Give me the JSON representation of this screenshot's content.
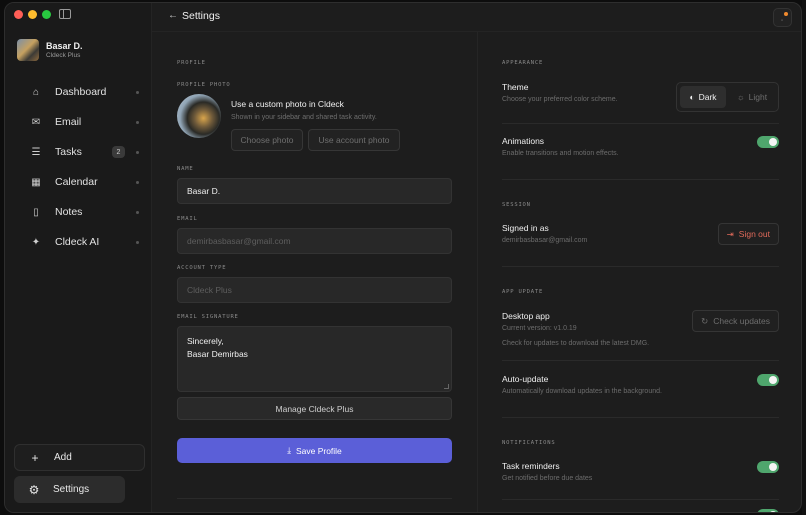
{
  "window": {
    "title": "Settings"
  },
  "sidebar": {
    "user": {
      "name": "Basar D.",
      "plan": "Cldeck Plus"
    },
    "items": [
      {
        "label": "Dashboard",
        "icon": "home-icon",
        "glyph": "⌂"
      },
      {
        "label": "Email",
        "icon": "mail-icon",
        "glyph": "✉"
      },
      {
        "label": "Tasks",
        "icon": "list-icon",
        "glyph": "☰",
        "badge": "2"
      },
      {
        "label": "Calendar",
        "icon": "calendar-icon",
        "glyph": "▦"
      },
      {
        "label": "Notes",
        "icon": "note-icon",
        "glyph": "▯"
      },
      {
        "label": "Cldeck AI",
        "icon": "ai-icon",
        "glyph": "✦"
      }
    ],
    "add_label": "Add",
    "settings_label": "Settings"
  },
  "profile_section": {
    "label": "PROFILE",
    "photo_label": "PROFILE PHOTO",
    "photo_title": "Use a custom photo in Cldeck",
    "photo_desc": "Shown in your sidebar and shared task activity.",
    "choose_photo": "Choose photo",
    "use_account_photo": "Use account photo",
    "name_label": "NAME",
    "name_value": "Basar D.",
    "email_label": "EMAIL",
    "email_value": "demirbasbasar@gmail.com",
    "account_type_label": "ACCOUNT TYPE",
    "account_type_value": "Cldeck Plus",
    "signature_label": "EMAIL SIGNATURE",
    "signature_line1": "Sincerely,",
    "signature_line2": "Basar Demirbas",
    "manage_label": "Manage Cldeck Plus",
    "save_label": "Save Profile"
  },
  "appearance": {
    "label": "APPEARANCE",
    "theme_title": "Theme",
    "theme_desc": "Choose your preferred color scheme.",
    "theme_dark": "Dark",
    "theme_light": "Light",
    "selected_theme": "Dark",
    "animations_title": "Animations",
    "animations_desc": "Enable transitions and motion effects.",
    "animations_on": true
  },
  "session": {
    "label": "SESSION",
    "signed_in_title": "Signed in as",
    "signed_in_email": "demirbasbasar@gmail.com",
    "sign_out": "Sign out"
  },
  "app_update": {
    "label": "APP UPDATE",
    "desktop_title": "Desktop app",
    "current_version": "Current version: v1.0.19",
    "check_desc": "Check for updates to download the latest DMG.",
    "check_label": "Check updates",
    "auto_title": "Auto-update",
    "auto_desc": "Automatically download updates in the background.",
    "auto_on": true
  },
  "notifications": {
    "label": "NOTIFICATIONS",
    "task_title": "Task reminders",
    "task_desc": "Get notified before due dates",
    "task_on": true
  },
  "colors": {
    "accent": "#5b5fd8",
    "toggle_on": "#4fa66d",
    "danger": "#e06a5a",
    "notif": "#f08a2e"
  }
}
